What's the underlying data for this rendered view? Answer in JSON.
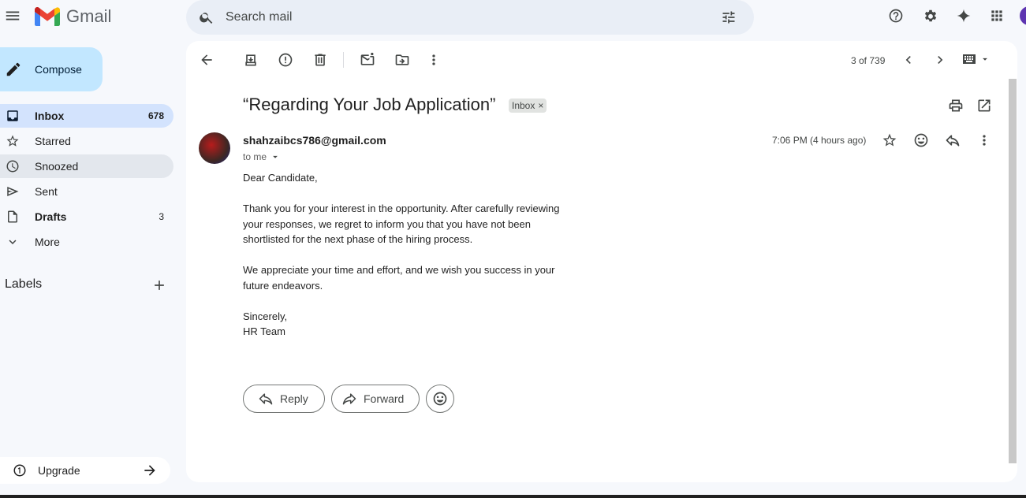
{
  "app": {
    "name": "Gmail"
  },
  "search": {
    "placeholder": "Search mail"
  },
  "compose": {
    "label": "Compose"
  },
  "sidebar": {
    "items": [
      {
        "label": "Inbox",
        "count": "678"
      },
      {
        "label": "Starred",
        "count": ""
      },
      {
        "label": "Snoozed",
        "count": ""
      },
      {
        "label": "Sent",
        "count": ""
      },
      {
        "label": "Drafts",
        "count": "3"
      },
      {
        "label": "More",
        "count": ""
      }
    ],
    "labels_heading": "Labels",
    "upgrade_label": "Upgrade"
  },
  "toolbar": {
    "pager": "3 of 739"
  },
  "message": {
    "subject": "“Regarding Your Job Application”",
    "chip": "Inbox",
    "chip_close": "×",
    "sender": "shahzaibcs786@gmail.com",
    "to": "to me",
    "time": "7:06 PM (4 hours ago)",
    "body": [
      "Dear Candidate,",
      "Thank you for your interest in the opportunity. After carefully reviewing your responses, we regret to inform you that you have not been shortlisted for the next phase of the hiring process.",
      "We appreciate your time and effort, and we wish you success in your future endeavors.",
      "Sincerely,",
      "HR Team"
    ]
  },
  "actions": {
    "reply": "Reply",
    "forward": "Forward"
  },
  "colors": {
    "accent": "#0b57d0",
    "compose_bg": "#c2e7ff",
    "selected_nav": "#d3e3fd",
    "page_bg": "#f6f8fc"
  }
}
